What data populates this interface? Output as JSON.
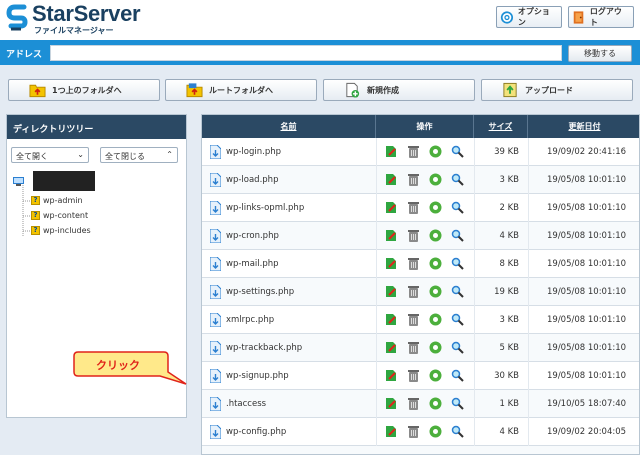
{
  "header": {
    "logo_title": "StarServer",
    "logo_subtitle": "ファイルマネージャー",
    "option_label": "オプション",
    "logout_label": "ログアウト"
  },
  "address_bar": {
    "label": "アドレス",
    "value": "",
    "go_label": "移動する"
  },
  "toolbar": {
    "up_label": "1つ上のフォルダへ",
    "root_label": "ルートフォルダへ",
    "new_label": "新規作成",
    "upload_label": "アップロード"
  },
  "dir_panel": {
    "title": "ディレクトリツリー",
    "expand_all": "全て開く",
    "collapse_all": "全て閉じる",
    "tree_items": [
      "wp-admin",
      "wp-content",
      "wp-includes"
    ]
  },
  "file_table": {
    "headers": {
      "name": "名前",
      "ops": "操作",
      "size": "サイズ",
      "date": "更新日付"
    },
    "rows": [
      {
        "name": "wp-login.php",
        "size": "39 KB",
        "date": "19/09/02 20:41:16"
      },
      {
        "name": "wp-load.php",
        "size": "3 KB",
        "date": "19/05/08 10:01:10"
      },
      {
        "name": "wp-links-opml.php",
        "size": "2 KB",
        "date": "19/05/08 10:01:10"
      },
      {
        "name": "wp-cron.php",
        "size": "4 KB",
        "date": "19/05/08 10:01:10"
      },
      {
        "name": "wp-mail.php",
        "size": "8 KB",
        "date": "19/05/08 10:01:10"
      },
      {
        "name": "wp-settings.php",
        "size": "19 KB",
        "date": "19/05/08 10:01:10"
      },
      {
        "name": "xmlrpc.php",
        "size": "3 KB",
        "date": "19/05/08 10:01:10"
      },
      {
        "name": "wp-trackback.php",
        "size": "5 KB",
        "date": "19/05/08 10:01:10"
      },
      {
        "name": "wp-signup.php",
        "size": "30 KB",
        "date": "19/05/08 10:01:10"
      },
      {
        "name": ".htaccess",
        "size": "1 KB",
        "date": "19/10/05 18:07:40"
      },
      {
        "name": "wp-config.php",
        "size": "4 KB",
        "date": "19/09/02 20:04:05"
      },
      {
        "name": "",
        "size": "",
        "date": ""
      }
    ]
  },
  "annotation": {
    "callout_text": "クリック"
  },
  "colors": {
    "header_bar": "#1c8fd6",
    "panel_header": "#2b4964",
    "callout_fill": "#ffe98a",
    "callout_stroke": "#e0231a"
  }
}
